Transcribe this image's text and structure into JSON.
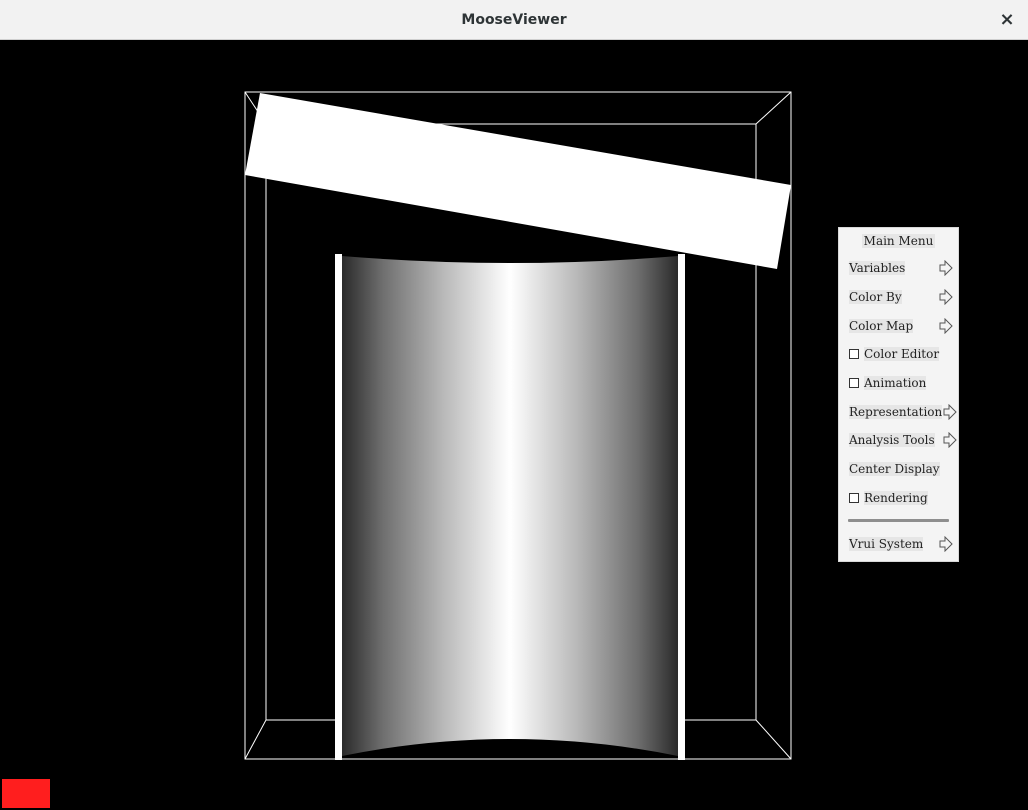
{
  "window": {
    "title": "MooseViewer",
    "close_glyph": "×"
  },
  "menu": {
    "title": "Main Menu",
    "items": [
      {
        "label": "Variables",
        "kind": "submenu"
      },
      {
        "label": "Color By",
        "kind": "submenu"
      },
      {
        "label": "Color Map",
        "kind": "submenu"
      },
      {
        "label": "Color Editor",
        "kind": "toggle",
        "checked": false
      },
      {
        "label": "Animation",
        "kind": "toggle",
        "checked": false
      },
      {
        "label": "Representation",
        "kind": "submenu"
      },
      {
        "label": "Analysis Tools",
        "kind": "submenu"
      },
      {
        "label": "Center Display",
        "kind": "button"
      },
      {
        "label": "Rendering",
        "kind": "toggle",
        "checked": false
      },
      {
        "label": "Vrui System",
        "kind": "submenu"
      }
    ]
  },
  "colors": {
    "background": "#000000",
    "titlebar": "#f2f2f2",
    "menu_bg": "#f4f4f4",
    "status_block": "#ff1e1e"
  },
  "icons": {
    "close": "close-icon",
    "submenu": "arrow-right-icon",
    "toggle": "checkbox-icon"
  }
}
